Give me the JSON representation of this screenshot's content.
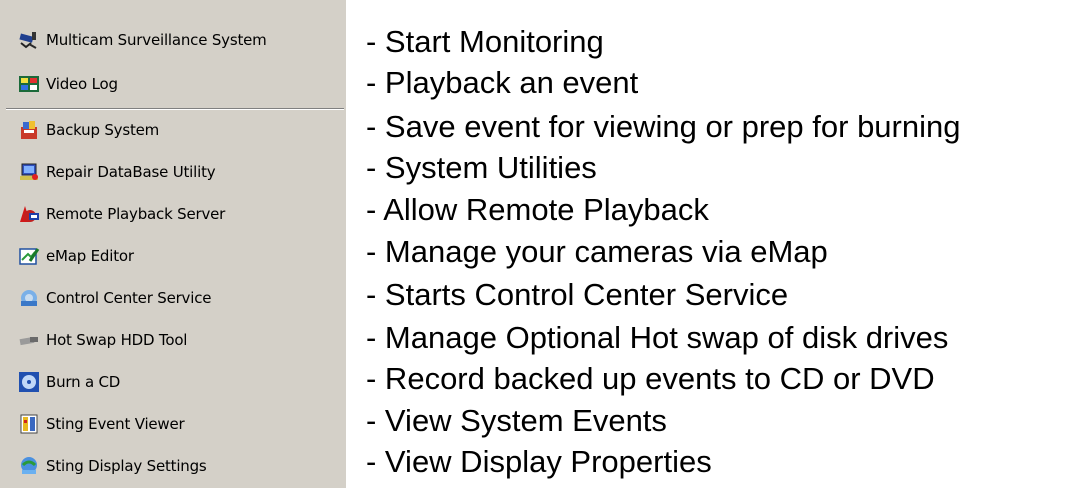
{
  "menu": {
    "items": [
      {
        "label": "Multicam Surveillance System",
        "icon": "surveillance-camera-icon"
      },
      {
        "label": "Video Log",
        "icon": "video-log-icon"
      },
      {
        "label": "Backup System",
        "icon": "backup-icon"
      },
      {
        "label": "Repair DataBase Utility",
        "icon": "repair-database-icon"
      },
      {
        "label": "Remote Playback Server",
        "icon": "remote-playback-icon"
      },
      {
        "label": "eMap Editor",
        "icon": "emap-editor-icon"
      },
      {
        "label": "Control Center Service",
        "icon": "control-center-icon"
      },
      {
        "label": "Hot Swap HDD Tool",
        "icon": "hot-swap-hdd-icon"
      },
      {
        "label": "Burn a CD",
        "icon": "burn-cd-icon"
      },
      {
        "label": "Sting Event Viewer",
        "icon": "event-viewer-icon"
      },
      {
        "label": "Sting Display Settings",
        "icon": "display-settings-icon"
      }
    ]
  },
  "descriptions": [
    "- Start Monitoring",
    "- Playback an event",
    "- Save event for viewing or prep for burning",
    "- System Utilities",
    "- Allow Remote Playback",
    "- Manage your cameras via eMap",
    "- Starts Control Center Service",
    "- Manage Optional Hot swap of disk drives",
    "- Record backed up events to CD or DVD",
    "- View System Events",
    "- View Display Properties"
  ]
}
